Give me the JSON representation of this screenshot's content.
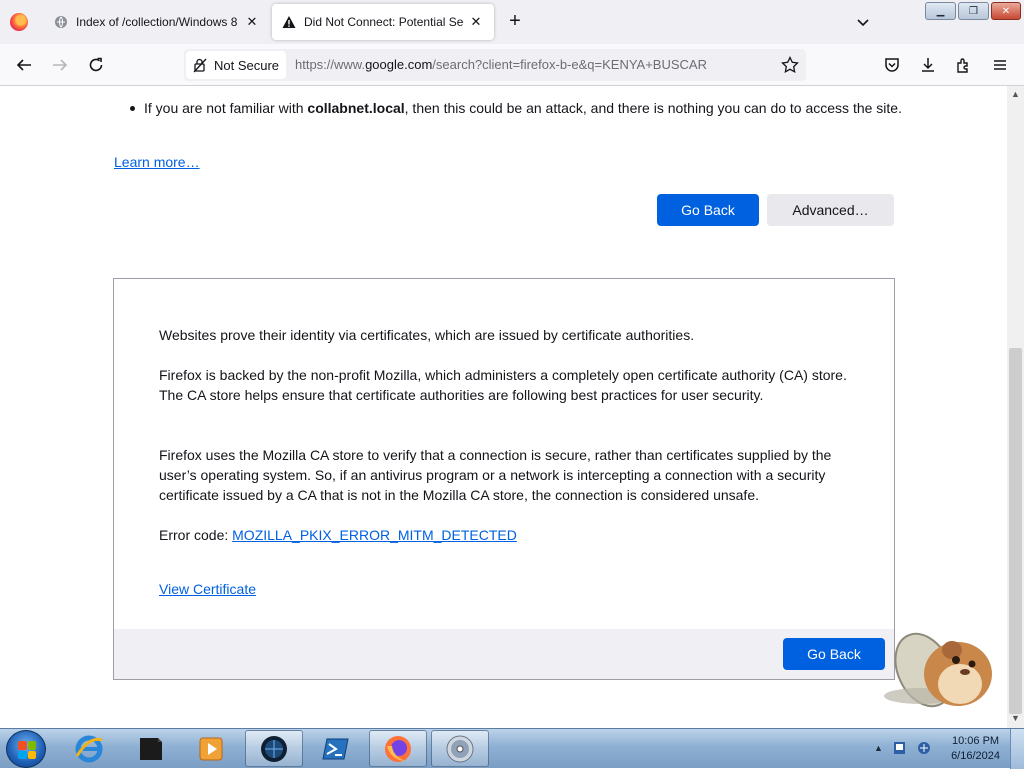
{
  "tabs": [
    {
      "label": "Index of /collection/Windows 8",
      "close": "✕"
    },
    {
      "label": "Did Not Connect: Potential Security Issue",
      "close": "✕"
    }
  ],
  "new_tab": "+",
  "window_controls": {
    "minimize": "▁",
    "maximize": "❐",
    "close": "✕"
  },
  "urlbar": {
    "identity": "Not Secure",
    "url_prefix": "https://www.",
    "url_domain": "google.com",
    "url_rest": "/search?client=firefox-b-e&q=KENYA+BUSCAR"
  },
  "content": {
    "bullet_text_pre": "If you are not familiar with ",
    "bullet_text_bold": "collabnet.local",
    "bullet_text_post": ", then this could be an attack, and there is nothing you can do to access the site.",
    "learn_more": "Learn more…",
    "go_back": "Go Back",
    "advanced": "Advanced…"
  },
  "panel": {
    "p1": "Websites prove their identity via certificates, which are issued by certificate authorities.",
    "p2": "Firefox is backed by the non-profit Mozilla, which administers a completely open certificate authority (CA) store. The CA store helps ensure that certificate authorities are following best practices for user security.",
    "p3": "Firefox uses the Mozilla CA store to verify that a connection is secure, rather than certificates supplied by the user’s operating system. So, if an antivirus program or a network is intercepting a connection with a security certificate issued by a CA that is not in the Mozilla CA store, the connection is considered unsafe.",
    "error_label": "Error code: ",
    "error_code": "MOZILLA_PKIX_ERROR_MITM_DETECTED",
    "view_certificate": "View Certificate",
    "go_back": "Go Back"
  },
  "taskbar": {
    "items": [
      "internet-explorer",
      "terminal",
      "media-player",
      "app-globe",
      "powershell",
      "firefox",
      "dvd-player"
    ],
    "clock_time": "10:06 PM",
    "clock_date": "6/16/2024"
  },
  "colors": {
    "accent": "#0061e0",
    "tabstrip": "#f0f0f4"
  }
}
